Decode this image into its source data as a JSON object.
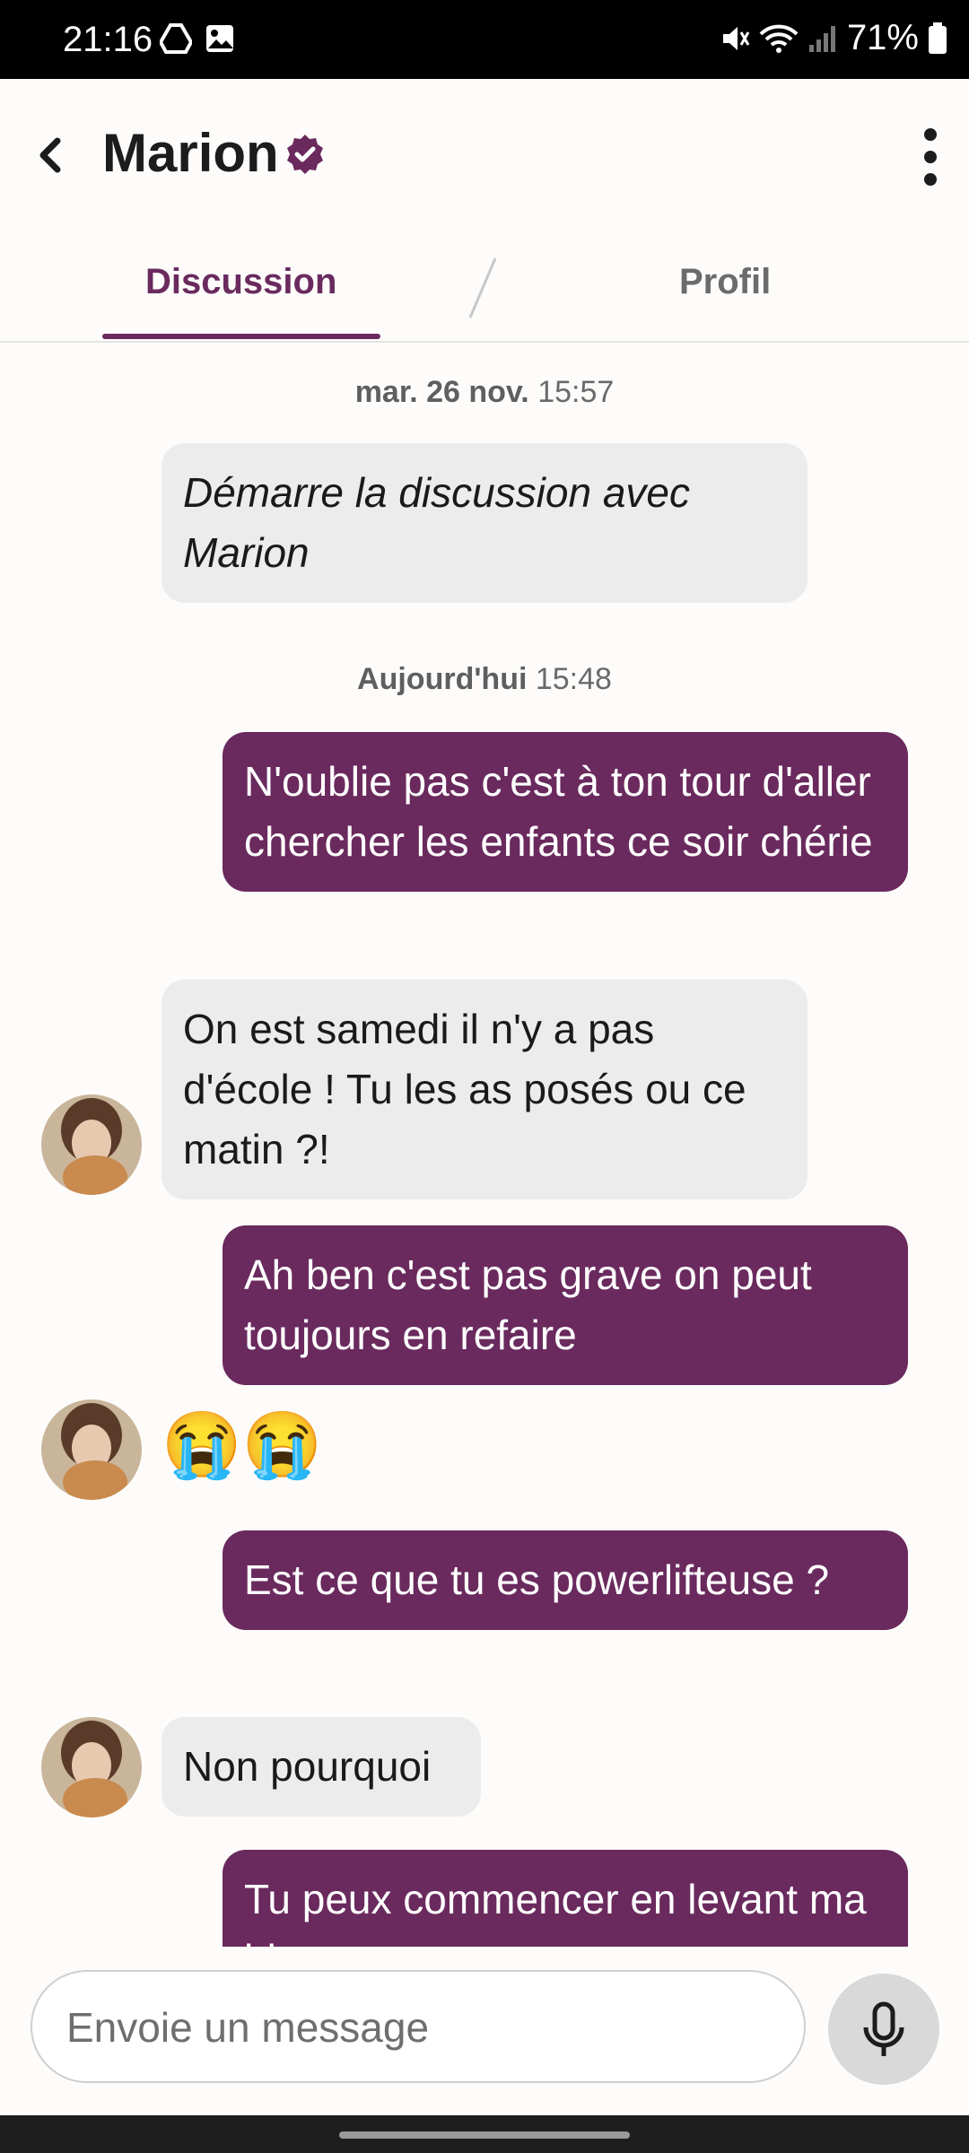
{
  "status": {
    "time": "21:16",
    "battery": "71%"
  },
  "header": {
    "title": "Marion"
  },
  "tabs": {
    "discussion": "Discussion",
    "profile": "Profil"
  },
  "dates": [
    {
      "day": "mar. 26 nov.",
      "time": "15:57"
    },
    {
      "day": "Aujourd'hui",
      "time": "15:48"
    }
  ],
  "messages": {
    "start": "Démarre la discussion avec Marion",
    "m1": "N'oublie pas c'est à ton tour d'aller chercher les enfants ce soir chérie",
    "m2": "On est samedi il n'y a pas d'école ! Tu les as posés ou ce matin ?!",
    "m3": "Ah ben c'est pas grave on peut toujours en refaire",
    "m4": "😭😭",
    "m5": "Est ce que tu es powerlifteuse ?",
    "m6": "Non pourquoi",
    "m7": "Tu peux commencer en levant ma bite"
  },
  "composer": {
    "placeholder": "Envoie un message"
  },
  "colors": {
    "accent": "#6a2a5e",
    "incoming": "#ececec"
  }
}
